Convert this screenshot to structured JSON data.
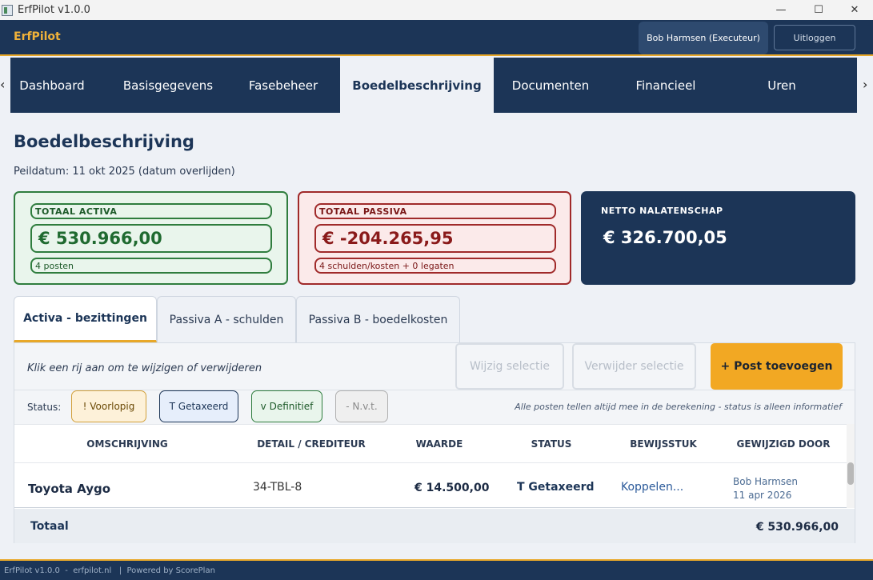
{
  "window": {
    "title": "ErfPilot v1.0.0",
    "controls": {
      "minimize": "—",
      "maximize": "☐",
      "close": "✕"
    }
  },
  "header": {
    "brand": "ErfPilot",
    "user": "Bob Harmsen (Executeur)",
    "logout": "Uitloggen"
  },
  "nav": {
    "prev": "‹",
    "next": "›",
    "tabs": [
      "Dashboard",
      "Basisgegevens",
      "Fasebeheer",
      "Boedelbeschrijving",
      "Documenten",
      "Financieel",
      "Uren"
    ],
    "active": "Boedelbeschrijving"
  },
  "page": {
    "title": "Boedelbeschrijving",
    "peildatum": "Peildatum: 11 okt 2025 (datum overlijden)"
  },
  "summary": {
    "activa": {
      "label": "TOTAAL ACTIVA",
      "amount": "€ 530.966,00",
      "sub": "4 posten",
      "color": "#2f7d3e"
    },
    "passiva": {
      "label": "TOTAAL PASSIVA",
      "amount": "€ -204.265,95",
      "sub": "4 schulden/kosten + 0 legaten",
      "color": "#a02a2a"
    },
    "netto": {
      "label": "NETTO NALATENSCHAP",
      "amount": "€ 326.700,05",
      "color": "#1c3557"
    }
  },
  "section_tabs": [
    "Activa - bezittingen",
    "Passiva A - schulden",
    "Passiva B - boedelkosten"
  ],
  "toolbar": {
    "hint": "Klik een rij aan om te wijzigen of verwijderen",
    "edit": "Wijzig selectie",
    "delete": "Verwijder selectie",
    "add": "+ Post toevoegen"
  },
  "status_filter": {
    "label": "Status:",
    "chips": [
      "! Voorlopig",
      "T Getaxeerd",
      "v Definitief",
      "- N.v.t."
    ],
    "note": "Alle posten tellen altijd mee in de berekening - status is alleen informatief"
  },
  "table": {
    "columns": [
      "OMSCHRIJVING",
      "DETAIL / CREDITEUR",
      "WAARDE",
      "STATUS",
      "BEWIJSSTUK",
      "GEWIJZIGD DOOR"
    ],
    "rows": [
      {
        "omschrijving": "Toyota Aygo",
        "detail": "34-TBL-8",
        "waarde": "€ 14.500,00",
        "status": "T Getaxeerd",
        "bewijsstuk": "Koppelen...",
        "door": "Bob Harmsen",
        "datum": "11 apr 2026"
      }
    ],
    "total_label": "Totaal",
    "total_value": "€ 530.966,00"
  },
  "footer": {
    "text": "ErfPilot v1.0.0  -  erfpilot.nl   |  Powered by ScorePlan"
  },
  "accent": "#e8a829"
}
